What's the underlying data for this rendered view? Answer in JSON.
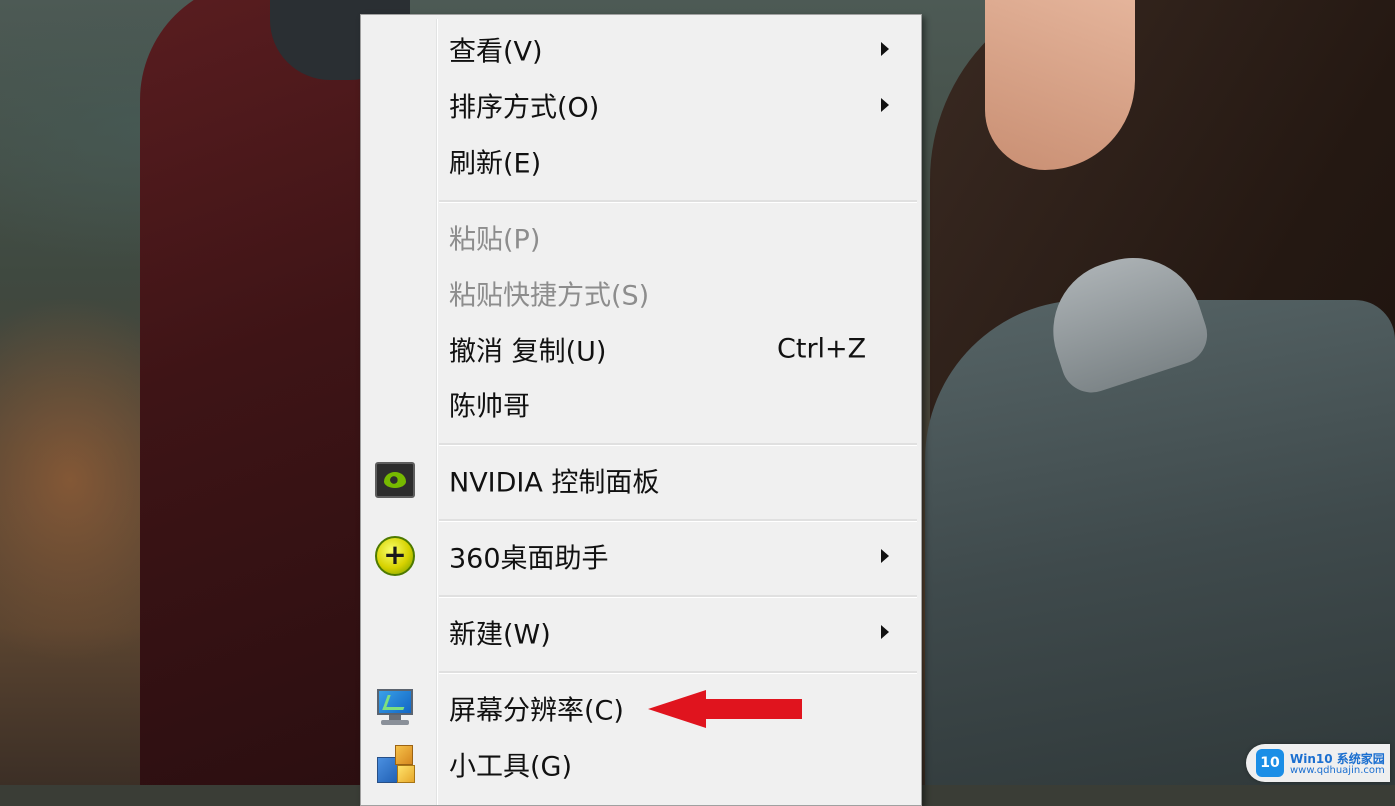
{
  "context_menu": {
    "items": [
      {
        "label": "查看(V)",
        "submenu": true
      },
      {
        "label": "排序方式(O)",
        "submenu": true
      },
      {
        "label": "刷新(E)"
      },
      {
        "label": "粘贴(P)",
        "disabled": true
      },
      {
        "label": "粘贴快捷方式(S)",
        "disabled": true
      },
      {
        "label": "撤消 复制(U)",
        "shortcut": "Ctrl+Z"
      },
      {
        "label": "陈帅哥"
      },
      {
        "label": "NVIDIA 控制面板",
        "icon": "nvidia-icon"
      },
      {
        "label": "360桌面助手",
        "icon": "360-desktop-icon",
        "submenu": true
      },
      {
        "label": "新建(W)",
        "submenu": true
      },
      {
        "label": "屏幕分辨率(C)",
        "icon": "display-icon"
      },
      {
        "label": "小工具(G)",
        "icon": "gadgets-icon"
      }
    ]
  },
  "annotation": {
    "color": "#e0141e",
    "icon": "red-arrow-icon"
  },
  "watermark": {
    "logo": "10",
    "title": "Win10 系统家园",
    "subtitle": "www.qdhuajin.com"
  }
}
